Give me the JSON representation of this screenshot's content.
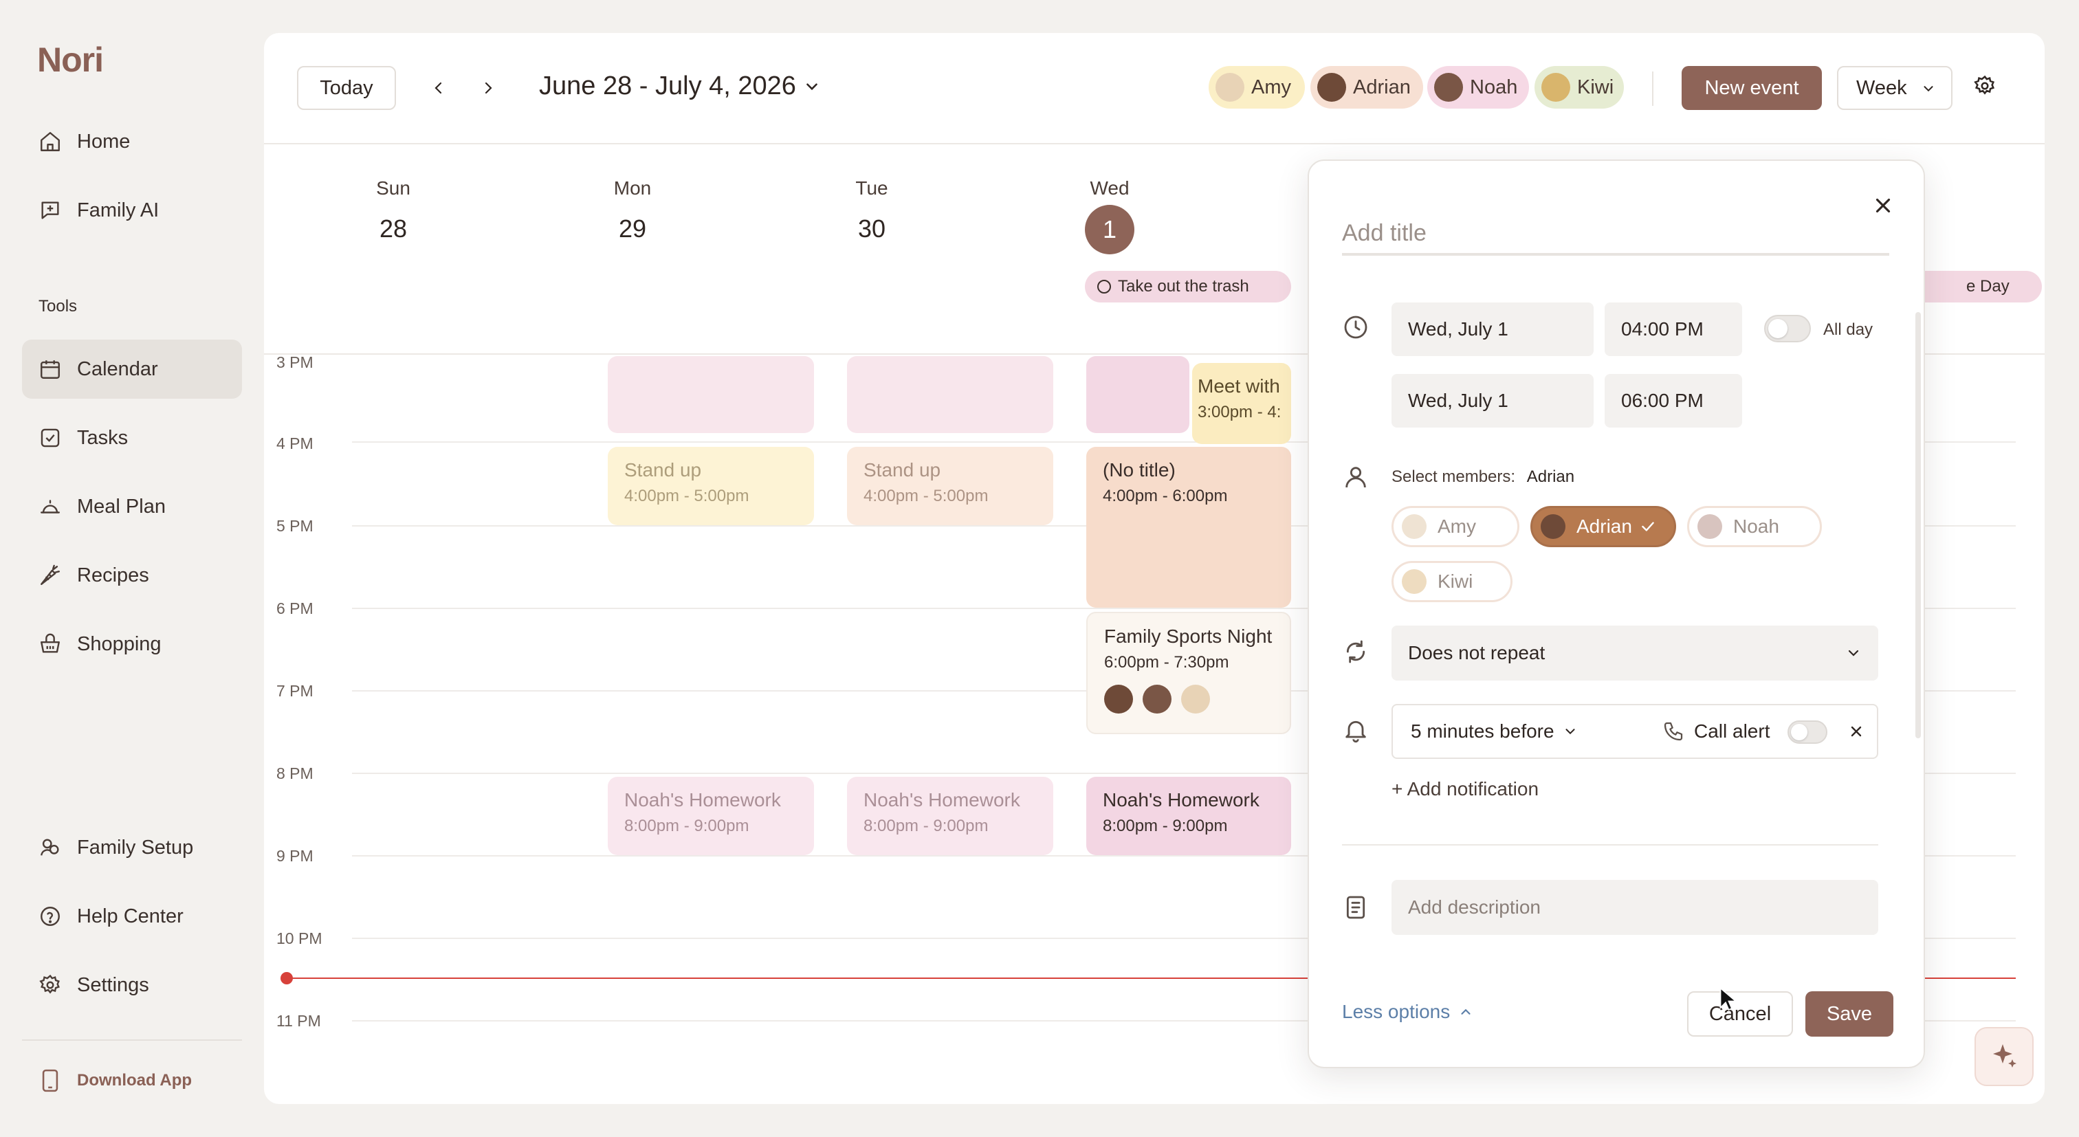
{
  "app": {
    "logo": "Nori"
  },
  "sidebar": {
    "items": [
      {
        "label": "Home",
        "icon": "home-icon"
      },
      {
        "label": "Family AI",
        "icon": "chat-plus-icon"
      }
    ],
    "tools_label": "Tools",
    "tools": [
      {
        "label": "Calendar",
        "icon": "calendar-icon",
        "active": true
      },
      {
        "label": "Tasks",
        "icon": "checkbox-icon"
      },
      {
        "label": "Meal Plan",
        "icon": "cloche-icon"
      },
      {
        "label": "Recipes",
        "icon": "carrot-icon"
      },
      {
        "label": "Shopping",
        "icon": "basket-icon"
      }
    ],
    "bottom": [
      {
        "label": "Family Setup",
        "icon": "family-icon"
      },
      {
        "label": "Help Center",
        "icon": "help-icon"
      },
      {
        "label": "Settings",
        "icon": "gear-icon"
      }
    ],
    "download": "Download App"
  },
  "toolbar": {
    "today": "Today",
    "range": "June 28 - July 4, 2026",
    "members": [
      {
        "name": "Amy",
        "bg": "#fbefc6"
      },
      {
        "name": "Adrian",
        "bg": "#f7e0d3"
      },
      {
        "name": "Noah",
        "bg": "#f6d9e5"
      },
      {
        "name": "Kiwi",
        "bg": "#e6ecd2"
      }
    ],
    "new_event": "New event",
    "view": "Week"
  },
  "days": [
    {
      "name": "Sun",
      "num": "28"
    },
    {
      "name": "Mon",
      "num": "29"
    },
    {
      "name": "Tue",
      "num": "30"
    },
    {
      "name": "Wed",
      "num": "1",
      "today": true
    }
  ],
  "all_day": {
    "trash": "Take out the trash",
    "partial": "e Day"
  },
  "hours": [
    "3 PM",
    "4 PM",
    "5 PM",
    "6 PM",
    "7 PM",
    "8 PM",
    "9 PM",
    "10 PM",
    "11 PM"
  ],
  "events": {
    "meet_title": "Meet with",
    "meet_time": "3:00pm - 4:",
    "standup_title": "Stand up",
    "standup_time": "4:00pm - 5:00pm",
    "notitle_title": "(No title)",
    "notitle_time": "4:00pm - 6:00pm",
    "sports_title": "Family Sports Night",
    "sports_time": "6:00pm - 7:30pm",
    "homework_title": "Noah's Homework",
    "homework_time": "8:00pm - 9:00pm"
  },
  "dialog": {
    "title_placeholder": "Add title",
    "start_date": "Wed, July 1",
    "start_time": "04:00 PM",
    "all_day": "All day",
    "end_date": "Wed, July 1",
    "end_time": "06:00 PM",
    "members_label": "Select members:",
    "members_selected": "Adrian",
    "members": [
      "Amy",
      "Adrian",
      "Noah",
      "Kiwi"
    ],
    "repeat": "Does not repeat",
    "notification": "5 minutes before",
    "call_alert": "Call alert",
    "add_notification": "+ Add notification",
    "description_placeholder": "Add description",
    "less_options": "Less options",
    "cancel": "Cancel",
    "save": "Save"
  },
  "colors": {
    "accent": "#8e6458",
    "selected_member": "#b77a4f",
    "now_line": "#d7413a",
    "link": "#5c7fa8"
  }
}
